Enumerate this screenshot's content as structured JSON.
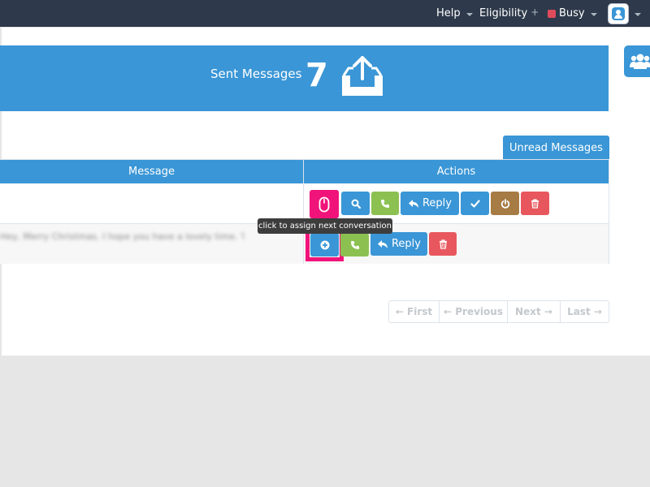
{
  "navbar": {
    "help_label": "Help",
    "eligibility_label": "Eligibility",
    "eligibility_mark": "+",
    "status_label": "Busy",
    "status_color": "#e04b5b"
  },
  "stats": {
    "label": "Sent Messages",
    "count": "7"
  },
  "tabs": {
    "unread_label": "Unread Messages"
  },
  "table": {
    "columns": [
      "Message",
      "Actions"
    ],
    "rows": [
      {
        "message": "",
        "reply_label": "Reply"
      },
      {
        "message": "Hey, Merry Christmas. I hope you have a lovely time. Talk soon? x",
        "reply_label": "Reply"
      }
    ]
  },
  "tooltip": {
    "text": "click to assign next conversation"
  },
  "pagination": {
    "first": "← First",
    "previous": "← Previous",
    "next": "Next →",
    "last": "Last →"
  },
  "colors": {
    "navbar": "#2e3a4b",
    "primary": "#3a96d6",
    "success": "#8cc152",
    "danger": "#e8575d",
    "warning_brown": "#a77b44",
    "highlight": "#f0147a"
  }
}
